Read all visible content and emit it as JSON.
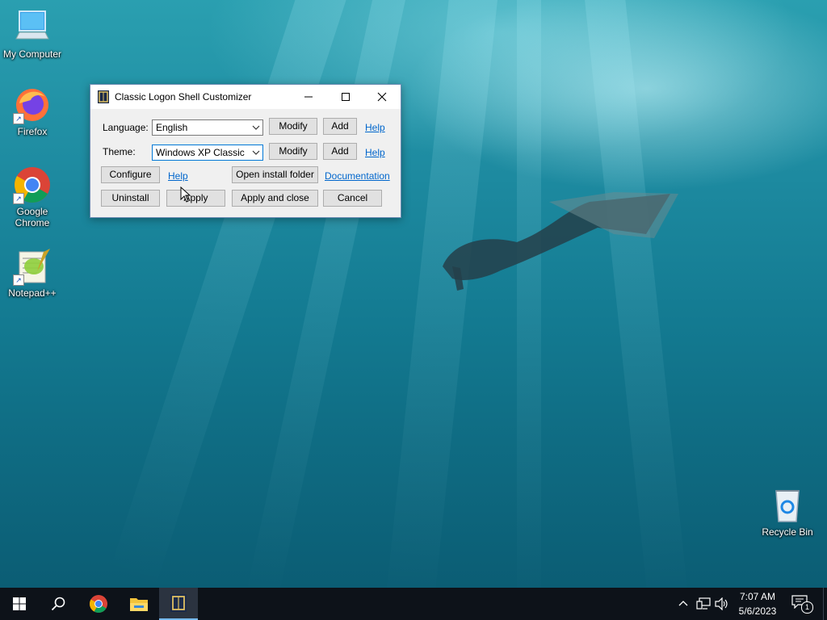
{
  "desktop": {
    "icons": [
      {
        "label": "My Computer"
      },
      {
        "label": "Firefox"
      },
      {
        "label": "Google Chrome"
      },
      {
        "label": "Notepad++"
      },
      {
        "label": "Recycle Bin"
      }
    ]
  },
  "dialog": {
    "title": "Classic Logon Shell Customizer",
    "language_label": "Language:",
    "language_value": "English",
    "theme_label": "Theme:",
    "theme_value": "Windows XP Classic",
    "modify_label": "Modify",
    "add_label": "Add",
    "help_label": "Help",
    "configure_label": "Configure",
    "open_install_folder_label": "Open install folder",
    "documentation_label": "Documentation",
    "uninstall_label": "Uninstall",
    "apply_label": "Apply",
    "apply_close_label": "Apply and close",
    "cancel_label": "Cancel"
  },
  "taskbar": {
    "time": "7:07 AM",
    "date": "5/6/2023",
    "notification_count": "1"
  },
  "colors": {
    "accent": "#0078d7",
    "link": "#0066cc",
    "taskbar": "#0d1219"
  }
}
